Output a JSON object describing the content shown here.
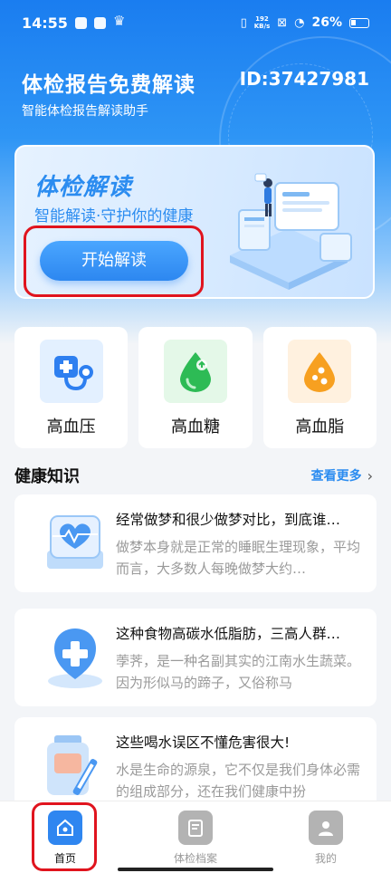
{
  "status_bar": {
    "time": "14:55",
    "speed_top": "192",
    "speed_unit": "KB/s",
    "battery": "26%"
  },
  "header": {
    "title": "体检报告免费解读",
    "id_label": "ID:37427981",
    "subtitle": "智能体检报告解读助手"
  },
  "banner": {
    "title": "体检解读",
    "subtitle": "智能解读·守护你的健康",
    "start_button": "开始解读"
  },
  "categories": [
    {
      "label": "高血压",
      "icon": "blood-pressure-icon",
      "bg": "#e3f0ff"
    },
    {
      "label": "高血糖",
      "icon": "green-drop-icon",
      "bg": "#e4f8e8"
    },
    {
      "label": "高血脂",
      "icon": "orange-drop-icon",
      "bg": "#fff1df"
    }
  ],
  "knowledge": {
    "title": "健康知识",
    "see_more": "查看更多"
  },
  "articles": [
    {
      "title": "经常做梦和很少做梦对比，到底谁…",
      "body": "做梦本身就是正常的睡眠生理现象，平均而言，大多数人每晚做梦大约…",
      "icon": "heart-monitor-icon"
    },
    {
      "title": "这种食物高碳水低脂肪，三高人群…",
      "body": "荸荠，是一种名副其实的江南水生蔬菜。因为形似马的蹄子，又俗称马",
      "icon": "medical-shield-icon"
    },
    {
      "title": "这些喝水误区不懂危害很大!",
      "body": "水是生命的源泉，它不仅是我们身体必需的组成部分，还在我们健康中扮",
      "icon": "medical-kit-icon"
    }
  ],
  "tabbar": [
    {
      "label": "首页",
      "icon": "home-icon",
      "active": true
    },
    {
      "label": "体检档案",
      "icon": "document-icon",
      "active": false
    },
    {
      "label": "我的",
      "icon": "user-icon",
      "active": false
    }
  ],
  "colors": {
    "accent": "#2b8cf0",
    "highlight": "#e0141e"
  }
}
